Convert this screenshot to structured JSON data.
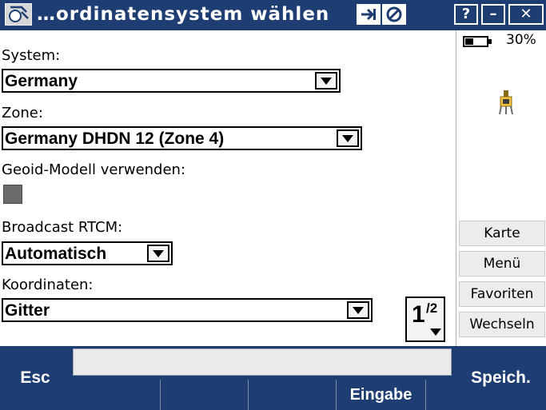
{
  "window": {
    "title": "…ordinatensystem wählen",
    "buttons": {
      "help": "?",
      "minimize": "–",
      "close": "✕"
    }
  },
  "form": {
    "system": {
      "label": "System:",
      "value": "Germany"
    },
    "zone": {
      "label": "Zone:",
      "value": "Germany DHDN 12 (Zone 4)"
    },
    "geoid": {
      "label": "Geoid-Modell verwenden:",
      "checked": false
    },
    "broadcast": {
      "label": "Broadcast RTCM:",
      "value": "Automatisch"
    },
    "koordinaten": {
      "label": "Koordinaten:",
      "value": "Gitter"
    },
    "page": {
      "current": "1",
      "total": "/2"
    }
  },
  "status": {
    "battery": "30%"
  },
  "sidebar": {
    "buttons": [
      "Karte",
      "Menü",
      "Favoriten",
      "Wechseln"
    ]
  },
  "bottom": {
    "esc": "Esc",
    "softkeys": [
      "",
      "",
      "",
      "Eingabe",
      ""
    ],
    "save": "Speich."
  },
  "colors": {
    "titlebar": "#1e3e73",
    "bottombar": "#1e3e73"
  }
}
